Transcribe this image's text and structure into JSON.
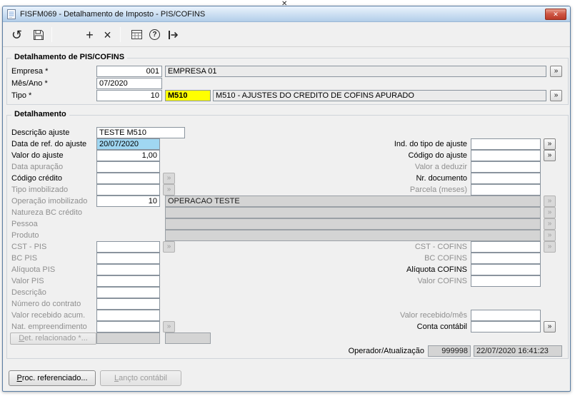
{
  "window": {
    "title": "FISFM069 - Detalhamento de Imposto - PIS/COFINS"
  },
  "icons": {
    "names": [
      "document-icon",
      "refresh-icon",
      "save-icon",
      "new-icon",
      "delete-icon",
      "calendar-icon",
      "help-icon",
      "exit-icon",
      "lookup-icon",
      "close-icon"
    ],
    "refresh": "↺",
    "new": "+",
    "delete": "×",
    "help": "?",
    "lookup": "»",
    "close": "✕",
    "artifact": "✕"
  },
  "header": {
    "title": "Detalhamento de PIS/COFINS",
    "empresa": {
      "label": "Empresa *",
      "code": "001",
      "name": "EMPRESA 01"
    },
    "mes_ano": {
      "label": "Mês/Ano *",
      "value": "07/2020"
    },
    "tipo": {
      "label": "Tipo *",
      "code": "10",
      "key": "M510",
      "desc": "M510 - AJUSTES DO CREDITO DE COFINS APURADO"
    }
  },
  "detail": {
    "title": "Detalhamento",
    "descricao_ajuste": {
      "label": "Descrição ajuste",
      "value": "TESTE M510"
    },
    "data_ref": {
      "label": "Data de ref. do ajuste",
      "value": "20/07/2020"
    },
    "valor_ajuste": {
      "label": "Valor do ajuste",
      "value": "1,00"
    },
    "data_apuracao": {
      "label": "Data apuração",
      "value": ""
    },
    "codigo_credito": {
      "label": "Código crédito",
      "value": ""
    },
    "tipo_imobilizado": {
      "label": "Tipo imobilizado",
      "value": ""
    },
    "operacao_imobilizado": {
      "label": "Operação imobilizado",
      "code": "10",
      "desc": "OPERACAO TESTE"
    },
    "natureza_bc": {
      "label": "Natureza BC crédito",
      "value": ""
    },
    "pessoa": {
      "label": "Pessoa",
      "value": ""
    },
    "produto": {
      "label": "Produto",
      "value": ""
    },
    "cst_pis": {
      "label": "CST - PIS",
      "value": ""
    },
    "bc_pis": {
      "label": "BC PIS",
      "value": ""
    },
    "aliquota_pis": {
      "label": "Alíquota PIS",
      "value": ""
    },
    "valor_pis": {
      "label": "Valor PIS",
      "value": ""
    },
    "descricao": {
      "label": "Descrição",
      "value": ""
    },
    "numero_contrato": {
      "label": "Número do contrato",
      "value": ""
    },
    "valor_recebido_acum": {
      "label": "Valor recebido acum.",
      "value": ""
    },
    "nat_empreendimento": {
      "label": "Nat. empreendimento",
      "value": ""
    },
    "ind_tipo_ajuste": {
      "label": "Ind. do tipo de ajuste",
      "value": ""
    },
    "codigo_ajuste": {
      "label": "Código do ajuste",
      "value": ""
    },
    "valor_deduzir": {
      "label": "Valor a deduzir",
      "value": ""
    },
    "nr_documento": {
      "label": "Nr. documento",
      "value": ""
    },
    "parcela_meses": {
      "label": "Parcela (meses)",
      "value": ""
    },
    "cst_cofins": {
      "label": "CST - COFINS",
      "value": ""
    },
    "bc_cofins": {
      "label": "BC COFINS",
      "value": ""
    },
    "aliquota_cofins": {
      "label": "Alíquota COFINS",
      "value": ""
    },
    "valor_cofins": {
      "label": "Valor COFINS",
      "value": ""
    },
    "valor_recebido_mes": {
      "label": "Valor recebido/mês",
      "value": ""
    },
    "conta_contabil": {
      "label": "Conta contábil",
      "value": ""
    },
    "det_relacionado": {
      "button_label": "Det. relacionado *...",
      "value1": "",
      "value2": ""
    },
    "operador": {
      "label": "Operador/Atualização",
      "id": "999998",
      "timestamp": "22/07/2020 16:41:23"
    }
  },
  "footer": {
    "proc_referenciado": "Proc. referenciado...",
    "lancto_contabil": "Lançto contábil"
  }
}
